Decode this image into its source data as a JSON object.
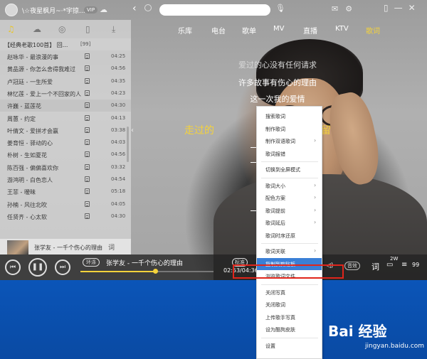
{
  "titlebar": {
    "user_name": "\\☆夜星枫月~·*宇掠...",
    "vip": "VIP"
  },
  "tabs": [
    "乐库",
    "电台",
    "歌单",
    "MV",
    "直播",
    "KTV",
    "歌词"
  ],
  "active_tab": "歌词",
  "playlist": {
    "title": "【经典老歌100首】 回...",
    "count": "[99]",
    "tracks": [
      {
        "name": "赵咏华 - 最浪漫的事",
        "time": "04:25"
      },
      {
        "name": "黄品源 - 你怎么舍得我难过",
        "time": "04:56"
      },
      {
        "name": "卢冠廷 - 一生所爱",
        "time": "04:35"
      },
      {
        "name": "林忆莲 - 爱上一个不回家的人",
        "time": "04:23"
      },
      {
        "name": "许巍 - 蓝莲花",
        "time": "04:30"
      },
      {
        "name": "周蕙 - 约定",
        "time": "04:13"
      },
      {
        "name": "叶倩文 - 爱拼才会赢",
        "time": "03:38"
      },
      {
        "name": "姜育恒 - 驿动的心",
        "time": "04:03"
      },
      {
        "name": "朴树 - 生如夏花",
        "time": "04:56"
      },
      {
        "name": "陈百强 - 偏偏喜欢你",
        "time": "03:32"
      },
      {
        "name": "游鸿明 - 白色恋人",
        "time": "04:54"
      },
      {
        "name": "王菲 - 暧昧",
        "time": "05:18"
      },
      {
        "name": "孙楠 - 风往北吹",
        "time": "04:05"
      },
      {
        "name": "任贤齐 - 心太软",
        "time": "04:30"
      }
    ]
  },
  "now_playing": {
    "title": "张学友 - 一千个伤心的理由",
    "lyric_btn": "词"
  },
  "lyrics": [
    "爱过的心没有任何请求",
    "许多故事有伤心的理由",
    "这一次我的爱情",
    "走过的",
    "留"
  ],
  "player": {
    "loop_tag": "环涤",
    "song": "张学友 - 一千个伤心的理由",
    "quality": "标准",
    "time": "02:53/04:36",
    "progress": 0.56,
    "sound_effect": "音效",
    "lyric_icon": "词",
    "comment_count": "2W",
    "list_count": "99"
  },
  "menu": {
    "items": [
      {
        "label": "搜索歌词",
        "arrow": false
      },
      {
        "label": "制作歌词",
        "arrow": false
      },
      {
        "label": "制作双语歌词",
        "arrow": true
      },
      {
        "label": "歌词报错",
        "arrow": false
      },
      {
        "label": "切换到全屏模式",
        "arrow": false
      },
      {
        "label": "歌词大小",
        "arrow": true
      },
      {
        "label": "配色方案",
        "arrow": true
      },
      {
        "label": "歌词提前",
        "arrow": true
      },
      {
        "label": "歌词延后",
        "arrow": true
      },
      {
        "label": "歌词时序还原",
        "arrow": false
      },
      {
        "label": "歌词关联",
        "arrow": true
      },
      {
        "label": "复制到剪贴板",
        "arrow": false,
        "active": true
      },
      {
        "label": "浏览歌词文件",
        "arrow": false
      },
      {
        "label": "关闭写真",
        "arrow": false
      },
      {
        "label": "关闭歌词",
        "arrow": false
      },
      {
        "label": "上传歌手写真",
        "arrow": false
      },
      {
        "label": "设为酷狗皮肤",
        "arrow": false
      },
      {
        "label": "设置",
        "arrow": false
      }
    ]
  },
  "watermark": {
    "brand": "Bai 经验",
    "site": "jingyan.baidu.com"
  },
  "colors": {
    "accent": "#f4d23b",
    "menu_highlight": "#3a7fd6",
    "annotation_red": "#e0251b",
    "desktop_blue": "#0b55b8"
  }
}
